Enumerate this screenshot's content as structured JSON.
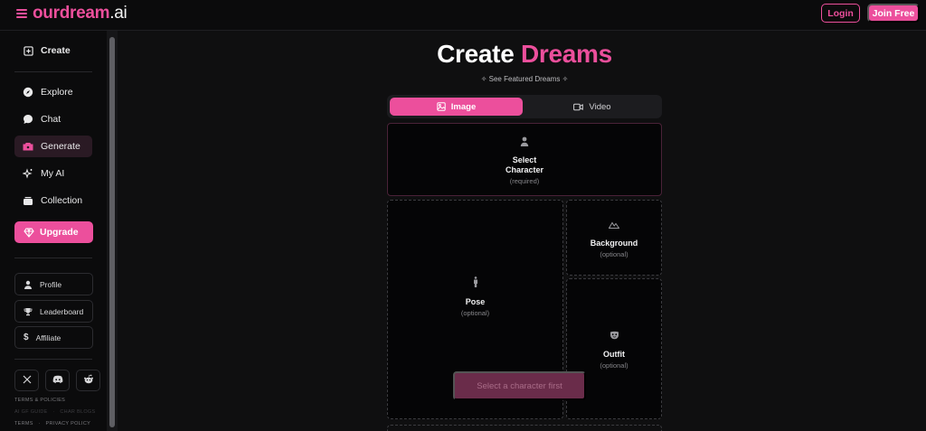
{
  "brand": {
    "name_part1": "ourdream",
    "name_part2": ".ai",
    "accent": "#ec4f9c"
  },
  "header": {
    "login_label": "Login",
    "join_label": "Join Free"
  },
  "sidebar": {
    "create": {
      "label": "Create",
      "icon": "plus-square-icon"
    },
    "items": [
      {
        "label": "Explore",
        "icon": "compass-icon"
      },
      {
        "label": "Chat",
        "icon": "chat-bubble-icon"
      },
      {
        "label": "Generate",
        "icon": "camera-icon",
        "active": true
      },
      {
        "label": "My AI",
        "icon": "sparkles-icon"
      },
      {
        "label": "Collection",
        "icon": "stack-icon"
      }
    ],
    "upgrade_label": "Upgrade",
    "links": [
      {
        "label": "Profile",
        "icon": "user-icon"
      },
      {
        "label": "Leaderboard",
        "icon": "trophy-icon"
      },
      {
        "label": "Affiliate",
        "icon": "dollar-icon"
      }
    ],
    "socials": [
      "x-icon",
      "discord-icon",
      "reddit-icon"
    ],
    "footer": {
      "terms_policies": "TERMS & POLICIES",
      "ai_gf_guide": "AI GF GUIDE",
      "chat_blogs": "CHAR BLOGS",
      "terms": "TERMS",
      "privacy": "PRIVACY POLICY",
      "separator": "·"
    }
  },
  "main": {
    "title_part1": "Create",
    "title_part2": "Dreams",
    "featured": "✧ See Featured Dreams ✧",
    "tabs": [
      {
        "label": "Image",
        "active": true
      },
      {
        "label": "Video",
        "active": false
      }
    ],
    "cards": {
      "character": {
        "line1": "Select",
        "line2": "Character",
        "sub": "(required)"
      },
      "background": {
        "label": "Background",
        "sub": "(optional)"
      },
      "pose": {
        "label": "Pose",
        "sub": "(optional)"
      },
      "outfit": {
        "label": "Outfit",
        "sub": "(optional)"
      }
    },
    "cta_label": "Select a character first"
  }
}
